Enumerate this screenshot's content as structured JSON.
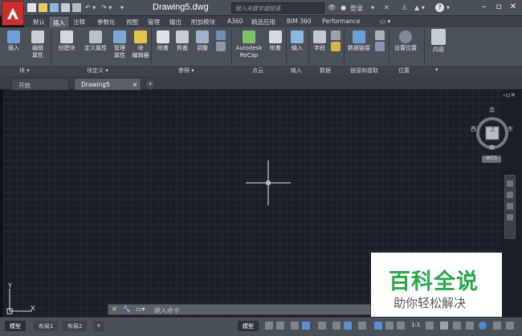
{
  "window": {
    "doc_title": "Drawing5.dwg",
    "search_placeholder": "键入关键字或短语",
    "login": "登录"
  },
  "ribbon_tabs": [
    "默认",
    "插入",
    "注释",
    "参数化",
    "视图",
    "管理",
    "输出",
    "附加模块",
    "A360",
    "精选应用",
    "BIM 360",
    "Performance"
  ],
  "active_tab": "插入",
  "ribbon": {
    "insert": "插入",
    "edit_attr_1": "编辑",
    "edit_attr_2": "属性",
    "create_block": "创建块",
    "define_attr": "定义属性",
    "manage_attr_1": "管理",
    "manage_attr_2": "属性",
    "block_editor_1": "块",
    "block_editor_2": "编辑器",
    "attach": "附着",
    "clip": "剪裁",
    "adjust": "调整",
    "recap_1": "Autodesk",
    "recap_2": "ReCap",
    "attach2": "附着",
    "import": "输入",
    "field": "字段",
    "data_link": "数据链接",
    "set_location": "设置位置",
    "content": "内容"
  },
  "panels": [
    "块 ▾",
    "块定义 ▾",
    "参照 ▾",
    "点云",
    "输入",
    "数据",
    "链接和提取",
    "位置"
  ],
  "doc_tabs": [
    "开始",
    "Drawing5"
  ],
  "viewcube": {
    "n": "北",
    "s": "南",
    "e": "东",
    "w": "西",
    "top": "上",
    "wcs": "WCS"
  },
  "command_placeholder": "键入命令",
  "layout_tabs": [
    "模型",
    "布局1",
    "布局2"
  ],
  "status": {
    "model": "模型",
    "scale": "1:1"
  },
  "watermark": {
    "title": "百科全说",
    "subtitle": "助你轻松解决"
  },
  "ucs": {
    "x": "X",
    "y": "Y"
  }
}
